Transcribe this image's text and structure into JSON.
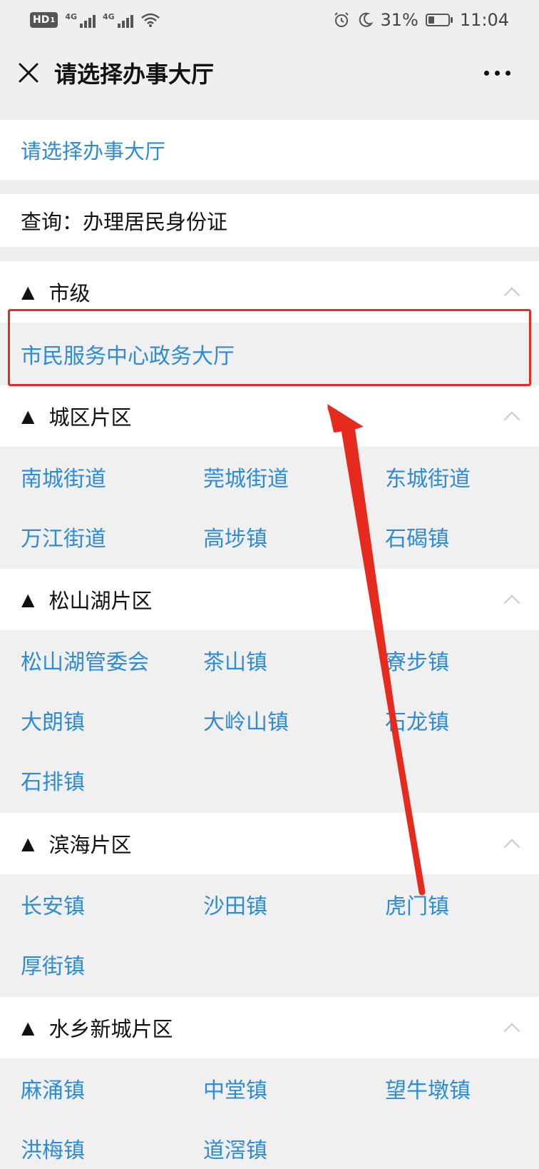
{
  "status_bar": {
    "hd": "HD",
    "hd_sub": "1",
    "net1": "4G",
    "net2": "4G",
    "battery_pct": "31%",
    "time": "11:04",
    "battery_level": 0.31
  },
  "navbar": {
    "title": "请选择办事大厅"
  },
  "select_title": "请选择办事大厅",
  "query": "查询：办理居民身份证",
  "sections": [
    {
      "title": "市级",
      "items": [
        "市民服务中心政务大厅"
      ]
    },
    {
      "title": "城区片区",
      "items": [
        "南城街道",
        "莞城街道",
        "东城街道",
        "万江街道",
        "高埗镇",
        "石碣镇"
      ]
    },
    {
      "title": "松山湖片区",
      "items": [
        "松山湖管委会",
        "茶山镇",
        "寮步镇",
        "大朗镇",
        "大岭山镇",
        "石龙镇",
        "石排镇"
      ]
    },
    {
      "title": "滨海片区",
      "items": [
        "长安镇",
        "沙田镇",
        "虎门镇",
        "厚街镇"
      ]
    },
    {
      "title": "水乡新城片区",
      "items": [
        "麻涌镇",
        "中堂镇",
        "望牛墩镇",
        "洪梅镇",
        "道滘镇"
      ]
    }
  ],
  "annotation_color": "#e62a1e",
  "accent_color": "#2e8bd6"
}
